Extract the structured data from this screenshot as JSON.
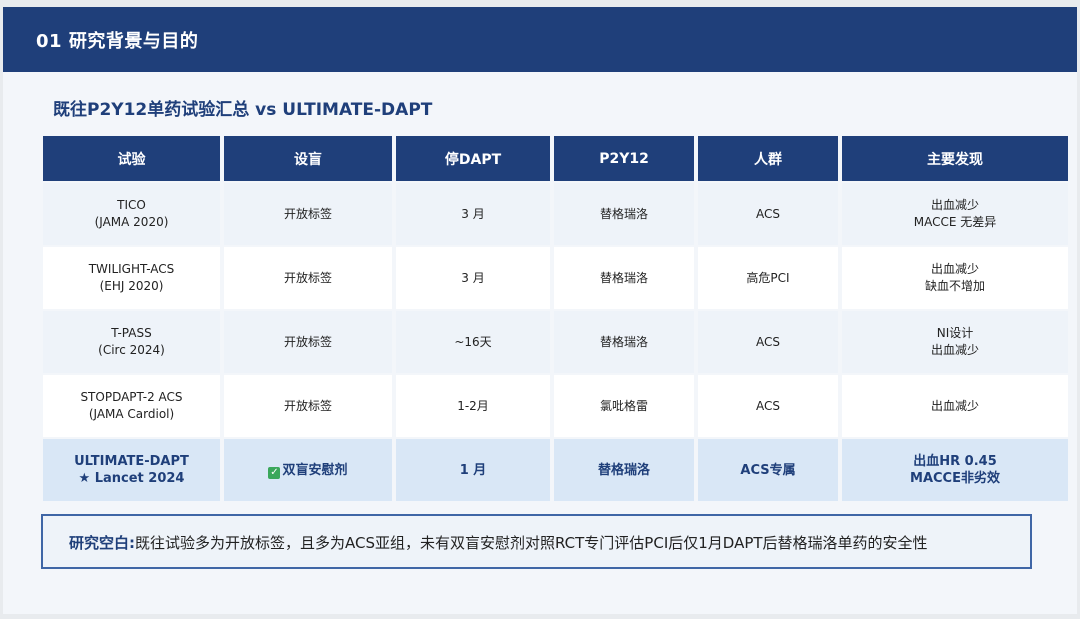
{
  "header": {
    "title": "01  研究背景与目的"
  },
  "subtitle": "既往P2Y12单药试验汇总 vs ULTIMATE-DAPT",
  "table": {
    "columns": [
      "试验",
      "设盲",
      "停DAPT",
      "P2Y12",
      "人群",
      "主要发现"
    ],
    "rows": [
      {
        "trial": [
          "TICO",
          "(JAMA 2020)"
        ],
        "blinding": "开放标签",
        "stop_dapt": "3 月",
        "p2y12": "替格瑞洛",
        "population": "ACS",
        "findings": [
          "出血减少",
          "MACCE 无差异"
        ]
      },
      {
        "trial": [
          "TWILIGHT-ACS",
          "(EHJ 2020)"
        ],
        "blinding": "开放标签",
        "stop_dapt": "3 月",
        "p2y12": "替格瑞洛",
        "population": "高危PCI",
        "findings": [
          "出血减少",
          "缺血不增加"
        ]
      },
      {
        "trial": [
          "T-PASS",
          "(Circ 2024)"
        ],
        "blinding": "开放标签",
        "stop_dapt": "~16天",
        "p2y12": "替格瑞洛",
        "population": "ACS",
        "findings": [
          "NI设计",
          "出血减少"
        ]
      },
      {
        "trial": [
          "STOPDAPT-2 ACS",
          "(JAMA Cardiol)"
        ],
        "blinding": "开放标签",
        "stop_dapt": "1-2月",
        "p2y12": "氯吡格雷",
        "population": "ACS",
        "findings": [
          "出血减少"
        ]
      }
    ],
    "highlight": {
      "trial": [
        "ULTIMATE-DAPT",
        "★ Lancet 2024"
      ],
      "check_glyph": "✓",
      "blinding": "双盲安慰剂",
      "stop_dapt": "1 月",
      "p2y12": "替格瑞洛",
      "population": "ACS专属",
      "findings": [
        "出血HR 0.45",
        "MACCE非劣效"
      ]
    }
  },
  "research_gap": {
    "label": "研究空白:",
    "text": "既往试验多为开放标签，且多为ACS亚组，未有双盲安慰剂对照RCT专门评估PCI后仅1月DAPT后替格瑞洛单药的安全性"
  },
  "colors": {
    "header_bg": "#1f3f7a",
    "highlight_row": "#d9e7f6",
    "check_green": "#3aa75b"
  }
}
